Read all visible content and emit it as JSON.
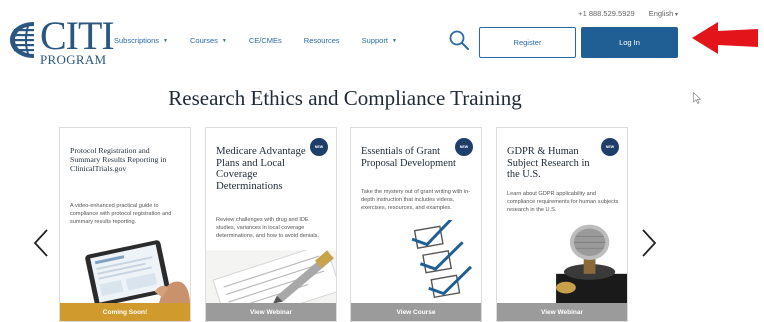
{
  "header": {
    "logo": {
      "brand": "CITI",
      "tagline": "PROGRAM"
    },
    "phone": "+1 888.529.5929",
    "language": "English",
    "nav": [
      {
        "label": "Subscriptions",
        "dropdown": true
      },
      {
        "label": "Courses",
        "dropdown": true
      },
      {
        "label": "CE/CMEs",
        "dropdown": false
      },
      {
        "label": "Resources",
        "dropdown": false
      },
      {
        "label": "Support",
        "dropdown": true
      }
    ],
    "search_icon": "search-icon",
    "register_label": "Register",
    "login_label": "Log In"
  },
  "main": {
    "title": "Research Ethics and Compliance Training",
    "prev_icon": "chevron-left-icon",
    "next_icon": "chevron-right-icon",
    "cards": [
      {
        "title": "Protocol Registration and Summary Results Reporting in ClinicalTrials.gov",
        "description": "A video-enhanced practical guide to compliance with protocol registration and summary results reporting.",
        "badge": "",
        "footer": "Coming Soon!",
        "illustration": "tablet-hand-icon"
      },
      {
        "title": "Medicare Advantage Plans and Local Coverage Determinations",
        "description": "Review challenges with drug and IDE studies, variances in local coverage determinations, and how to avoid denials.",
        "badge": "NEW",
        "footer": "View Webinar",
        "illustration": "pen-document-icon"
      },
      {
        "title": "Essentials of Grant Proposal Development",
        "description": "Take the mystery out of grant writing with in-depth instruction that includes videos, exercises, resources, and examples.",
        "badge": "NEW",
        "footer": "View Course",
        "illustration": "checkboxes-icon"
      },
      {
        "title": "GDPR & Human Subject Research in the U.S.",
        "description": "Learn about GDPR applicability and compliance requirements for human subjects research in the U.S.",
        "badge": "NEW",
        "footer": "View Webinar",
        "illustration": "microphone-icon"
      }
    ]
  },
  "colors": {
    "brand_blue": "#2a5680",
    "link_blue": "#2a6aa8",
    "login_bg": "#1f5f93",
    "badge_navy": "#1f3f6b",
    "footer_gold": "#d09a2d",
    "footer_gray": "#9b9b9b",
    "annotation_red": "#e4141b"
  }
}
